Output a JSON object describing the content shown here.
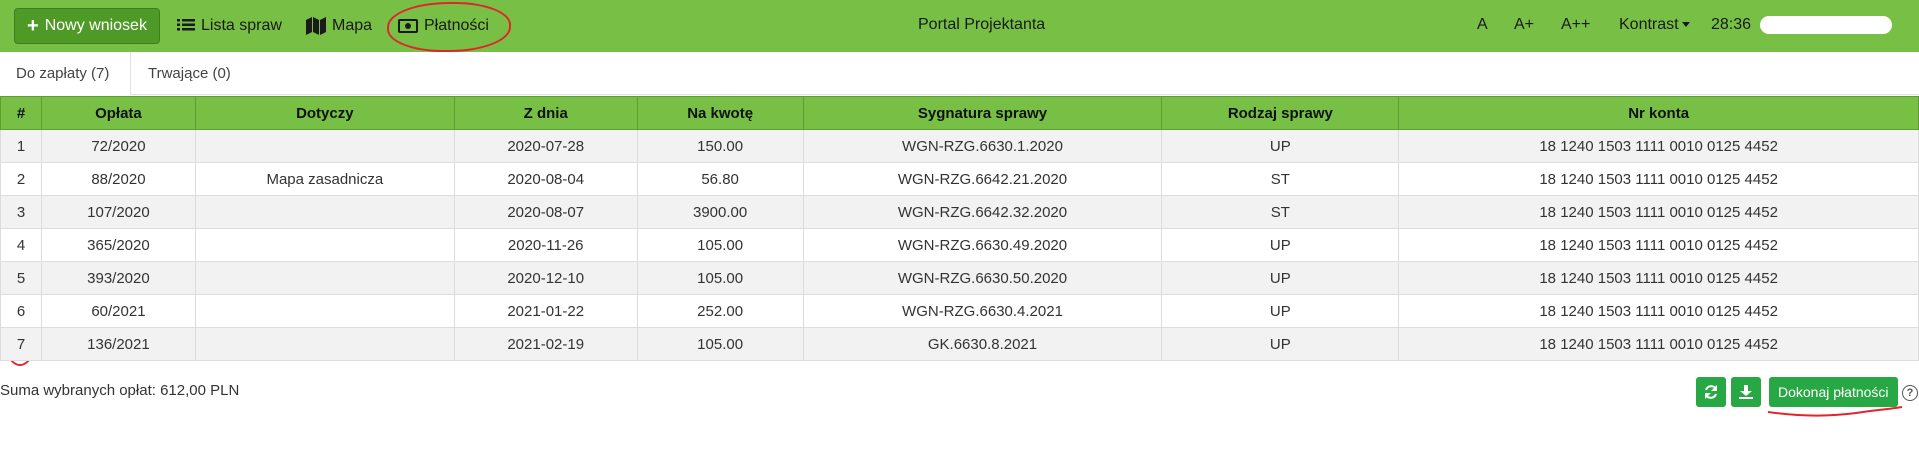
{
  "navbar": {
    "new_request_label": "Nowy wniosek",
    "case_list_label": "Lista spraw",
    "map_label": "Mapa",
    "payments_label": "Płatności",
    "title": "Portal Projektanta",
    "font_small": "A",
    "font_medium": "A+",
    "font_large": "A++",
    "contrast_label": "Kontrast",
    "session_timer": "28:36"
  },
  "tabs": [
    {
      "label": "Do zapłaty (7)"
    },
    {
      "label": "Trwające (0)"
    }
  ],
  "table": {
    "headers": [
      "#",
      "Opłata",
      "Dotyczy",
      "Z dnia",
      "Na kwotę",
      "Sygnatura sprawy",
      "Rodzaj sprawy",
      "Nr konta"
    ],
    "rows": [
      [
        "1",
        "72/2020",
        "",
        "2020-07-28",
        "150.00",
        "WGN-RZG.6630.1.2020",
        "UP",
        "18 1240 1503 1111 0010 0125 4452"
      ],
      [
        "2",
        "88/2020",
        "Mapa zasadnicza",
        "2020-08-04",
        "56.80",
        "WGN-RZG.6642.21.2020",
        "ST",
        "18 1240 1503 1111 0010 0125 4452"
      ],
      [
        "3",
        "107/2020",
        "",
        "2020-08-07",
        "3900.00",
        "WGN-RZG.6642.32.2020",
        "ST",
        "18 1240 1503 1111 0010 0125 4452"
      ],
      [
        "4",
        "365/2020",
        "",
        "2020-11-26",
        "105.00",
        "WGN-RZG.6630.49.2020",
        "UP",
        "18 1240 1503 1111 0010 0125 4452"
      ],
      [
        "5",
        "393/2020",
        "",
        "2020-12-10",
        "105.00",
        "WGN-RZG.6630.50.2020",
        "UP",
        "18 1240 1503 1111 0010 0125 4452"
      ],
      [
        "6",
        "60/2021",
        "",
        "2021-01-22",
        "252.00",
        "WGN-RZG.6630.4.2021",
        "UP",
        "18 1240 1503 1111 0010 0125 4452"
      ],
      [
        "7",
        "136/2021",
        "",
        "2021-02-19",
        "105.00",
        "GK.6630.8.2021",
        "UP",
        "18 1240 1503 1111 0010 0125 4452"
      ]
    ]
  },
  "footer": {
    "sum_text": "Suma wybranych opłat: 612,00 PLN",
    "refresh_icon": "refresh-icon",
    "download_icon": "download-icon",
    "pay_label": "Dokonaj płatności",
    "help_glyph": "?"
  },
  "colors": {
    "navbar": "#78bf45",
    "primary_button": "#4f9a27",
    "action_button": "#28a745",
    "annotation": "#e0262a"
  }
}
